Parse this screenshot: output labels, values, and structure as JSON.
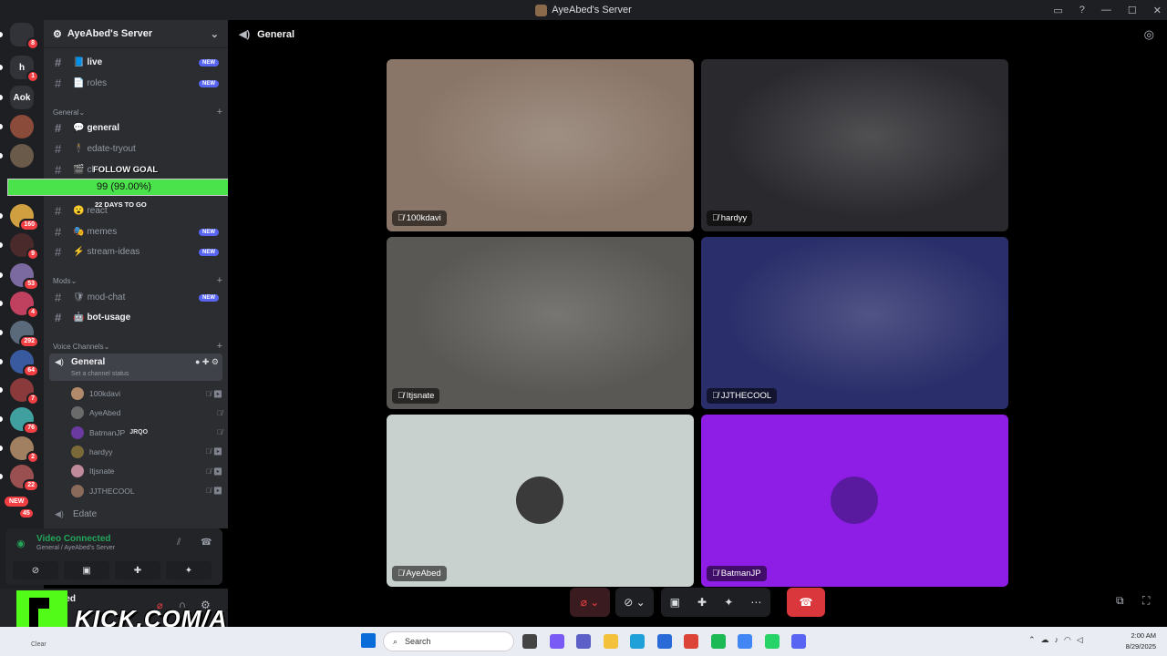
{
  "window": {
    "title": "AyeAbed's Server",
    "buttons": [
      "▭",
      "?",
      "—",
      "☐",
      "✕"
    ]
  },
  "guilds": {
    "items": [
      {
        "name": "discord-home",
        "label": "",
        "badge": "8",
        "color": "#313338"
      },
      {
        "name": "server-h",
        "label": "h",
        "badge": "1",
        "color": "#313338"
      },
      {
        "name": "server-aok",
        "label": "Aok",
        "badge": "",
        "color": "#313338"
      },
      {
        "name": "server-1",
        "label": "",
        "badge": "",
        "color": "#8a4b3a"
      },
      {
        "name": "server-2",
        "label": "",
        "badge": "",
        "color": "#6a5a4a"
      },
      {
        "name": "server-3",
        "label": "",
        "badge": "160",
        "color": "#d0a040"
      },
      {
        "name": "server-4",
        "label": "",
        "badge": "9",
        "color": "#4a2a2a"
      },
      {
        "name": "server-5",
        "label": "",
        "badge": "53",
        "color": "#7a6aa0"
      },
      {
        "name": "server-6",
        "label": "",
        "badge": "4",
        "color": "#c04060"
      },
      {
        "name": "server-7",
        "label": "",
        "badge": "292",
        "color": "#5a6a7a"
      },
      {
        "name": "server-8",
        "label": "",
        "badge": "64",
        "color": "#3a5aa0"
      },
      {
        "name": "server-9",
        "label": "",
        "badge": "7",
        "color": "#8a3a3a"
      },
      {
        "name": "server-10",
        "label": "",
        "badge": "76",
        "color": "#40a0a0"
      },
      {
        "name": "server-11",
        "label": "",
        "badge": "2",
        "color": "#a08060"
      },
      {
        "name": "server-12",
        "label": "",
        "badge": "22",
        "color": "#9a5050"
      }
    ],
    "new_label": "NEW",
    "new_count": "45"
  },
  "server": {
    "name": "AyeAbed's Server"
  },
  "channels": [
    {
      "name": "live",
      "icon": "📘",
      "new": true,
      "bright": true
    },
    {
      "name": "roles",
      "icon": "📄",
      "new": true,
      "bright": false
    },
    {
      "name": "general",
      "icon": "💬",
      "new": false,
      "bright": true
    },
    {
      "name": "edate-tryout",
      "icon": "🕴",
      "new": false,
      "bright": false
    },
    {
      "name": "cl",
      "icon": "🎬",
      "new": false,
      "bright": false
    },
    {
      "name": "react",
      "icon": "😮",
      "new": false,
      "bright": false
    },
    {
      "name": "memes",
      "icon": "🎭",
      "new": true,
      "bright": false
    },
    {
      "name": "stream-ideas",
      "icon": "⚡",
      "new": true,
      "bright": false
    },
    {
      "name": "mod-chat",
      "icon": "🛡",
      "new": true,
      "bright": false
    },
    {
      "name": "bot-usage",
      "icon": "🤖",
      "new": false,
      "bright": true
    }
  ],
  "categories": {
    "general": "General",
    "mods": "Mods",
    "voice": "Voice Channels"
  },
  "new_badge": "NEW",
  "voice_channel": {
    "name": "General",
    "status": "Set a channel status",
    "users": [
      {
        "name": "100kdavi",
        "color": "#b08a6a",
        "icons": "🎙̸ ▶",
        "tag": ""
      },
      {
        "name": "AyeAbed",
        "color": "#6a6a6a",
        "icons": "🎙̸",
        "tag": ""
      },
      {
        "name": "BatmanJP",
        "color": "#6a3aa0",
        "icons": "🎙̸",
        "tag": "JRQO"
      },
      {
        "name": "hardyy",
        "color": "#7a6a3a",
        "icons": "🎙̸ ▶",
        "tag": ""
      },
      {
        "name": "Itjsnate",
        "color": "#c08a9a",
        "icons": "🎙̸ ▶",
        "tag": ""
      },
      {
        "name": "JJTHECOOL",
        "color": "#8a6a5a",
        "icons": "🎙̸ ▶",
        "tag": ""
      }
    ],
    "next_channel": "Edate"
  },
  "follow_goal": {
    "title": "FOLLOW GOAL",
    "value_text": "99 (99.00%)",
    "progress": 0.99,
    "days_left": "22 DAYS TO GO",
    "target": "100"
  },
  "voice_panel": {
    "title": "Video Connected",
    "subtitle": "General / AyeAbed's Server"
  },
  "user_panel": {
    "name": "Abed"
  },
  "kick": {
    "text": "KICK.COM/AYEABED"
  },
  "stage": {
    "channel": "General",
    "tiles": [
      {
        "name": "100kdavi",
        "bg": "#8a7668"
      },
      {
        "name": "hardyy",
        "bg": "#2a2a2e"
      },
      {
        "name": "Itjsnate",
        "bg": "#5a5854"
      },
      {
        "name": "JJTHECOOL",
        "bg": "#2a2e6a"
      },
      {
        "name": "AyeAbed",
        "bg": "#c9d1cf",
        "avatar": "#3a3a3a"
      },
      {
        "name": "BatmanJP",
        "bg": "#8e1ee6",
        "avatar": "#5a1aa0"
      }
    ]
  },
  "taskbar": {
    "search": "Search",
    "time": "2:00 AM",
    "date": "8/29/2025",
    "weather": "Clear"
  }
}
